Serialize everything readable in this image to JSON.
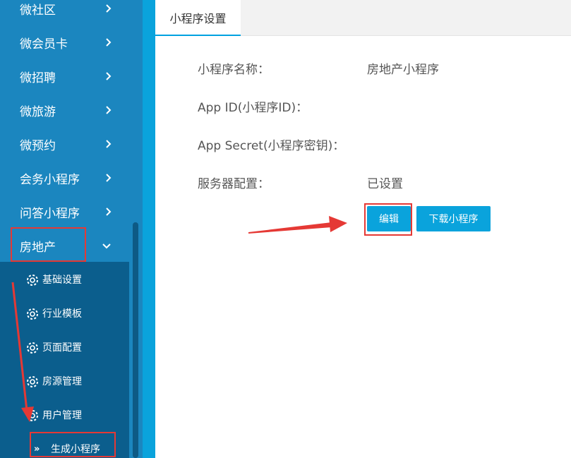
{
  "sidebar": {
    "items": [
      {
        "label": "微社区"
      },
      {
        "label": "微会员卡"
      },
      {
        "label": "微招聘"
      },
      {
        "label": "微旅游"
      },
      {
        "label": "微预约"
      },
      {
        "label": "会务小程序"
      },
      {
        "label": "问答小程序"
      },
      {
        "label": "房地产"
      }
    ],
    "submenu": [
      {
        "label": "基础设置"
      },
      {
        "label": "行业模板"
      },
      {
        "label": "页面配置"
      },
      {
        "label": "房源管理"
      },
      {
        "label": "用户管理"
      },
      {
        "label": "生成小程序"
      }
    ],
    "active_marker": "»"
  },
  "tabs": [
    {
      "label": "小程序设置"
    }
  ],
  "form": {
    "name_label": "小程序名称：",
    "name_value": "房地产小程序",
    "appid_label": "App ID(小程序ID)：",
    "appid_value": "",
    "secret_label": "App Secret(小程序密钥)：",
    "secret_value": "",
    "server_label": "服务器配置：",
    "server_value": "已设置"
  },
  "buttons": {
    "edit": "编辑",
    "download": "下载小程序"
  },
  "colors": {
    "sidebar": "#1b86bf",
    "submenu": "#0b5e8d",
    "accent": "#0aa3dc",
    "highlight": "#e53935"
  }
}
